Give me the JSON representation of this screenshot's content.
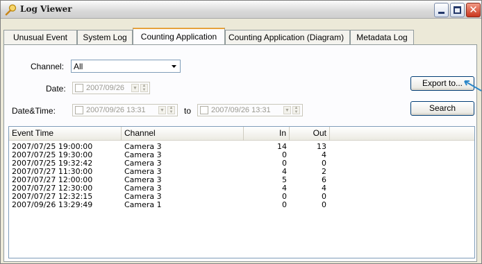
{
  "window": {
    "title": "Log Viewer",
    "title_icon": "magnifier-icon",
    "controls": {
      "minimize": "minimize-icon",
      "maximize": "maximize-icon",
      "close": "close-icon"
    }
  },
  "tabs": [
    {
      "label": "Unusual Event",
      "active": false
    },
    {
      "label": "System Log",
      "active": false
    },
    {
      "label": "Counting Application",
      "active": true
    },
    {
      "label": "Counting Application (Diagram)",
      "active": false
    },
    {
      "label": "Metadata Log",
      "active": false
    }
  ],
  "form": {
    "channel_label": "Channel:",
    "channel_value": "All",
    "date_label": "Date:",
    "date_value": "2007/09/26",
    "datetime_label": "Date&Time:",
    "datetime_from": "2007/09/26 13:31",
    "to_label": "to",
    "datetime_to": "2007/09/26 13:31",
    "export_label": "Export to...",
    "search_label": "Search"
  },
  "table": {
    "columns": [
      "Event Time",
      "Channel",
      "In",
      "Out"
    ],
    "rows": [
      [
        "2007/07/25 19:00:00",
        "Camera 3",
        "14",
        "13"
      ],
      [
        "2007/07/25 19:30:00",
        "Camera 3",
        "0",
        "4"
      ],
      [
        "2007/07/25 19:32:42",
        "Camera 3",
        "0",
        "0"
      ],
      [
        "2007/07/27 11:30:00",
        "Camera 3",
        "4",
        "2"
      ],
      [
        "2007/07/27 12:00:00",
        "Camera 3",
        "5",
        "6"
      ],
      [
        "2007/07/27 12:30:00",
        "Camera 3",
        "4",
        "4"
      ],
      [
        "2007/07/27 12:32:15",
        "Camera 3",
        "0",
        "0"
      ],
      [
        "2007/09/26 13:29:49",
        "Camera 1",
        "0",
        "0"
      ]
    ]
  },
  "colors": {
    "active_tab_accent": "#e6a23c",
    "window_face": "#ece9d8",
    "field_border": "#7f9db9",
    "annotation_pointer": "#2a86c8"
  }
}
